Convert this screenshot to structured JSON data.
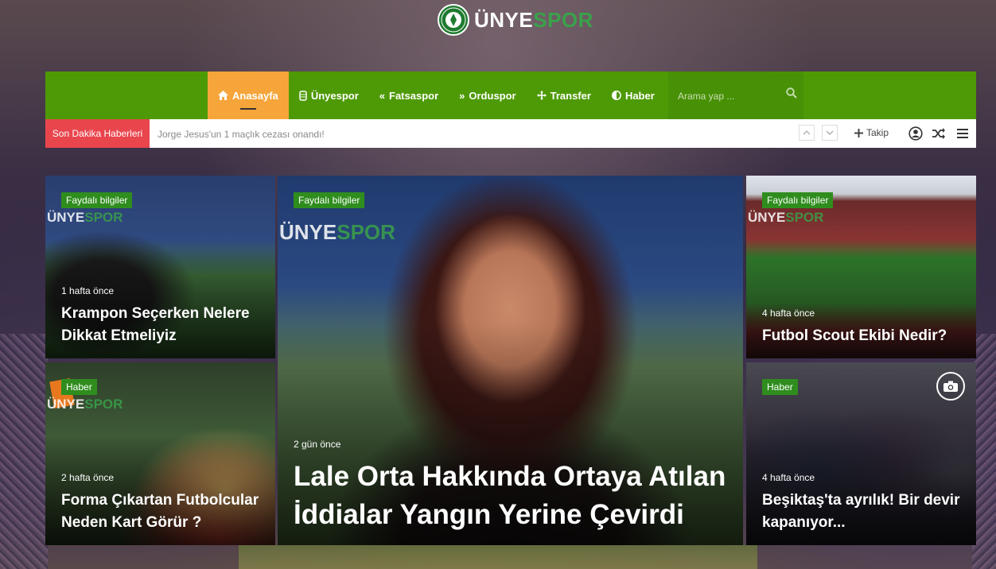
{
  "logo": {
    "part1": "ÜNYE",
    "part2": "SPOR",
    "badge_text": "ÜNYE SPOR"
  },
  "nav": {
    "items": [
      {
        "label": "Anasayfa",
        "icon": "home-icon",
        "active": true
      },
      {
        "label": "Ünyespor",
        "icon": "team-icon"
      },
      {
        "label": "Fatsaspor",
        "icon": "double-chevron-left-icon"
      },
      {
        "label": "Orduspor",
        "icon": "double-chevron-right-icon"
      },
      {
        "label": "Transfer",
        "icon": "arrows-move-icon"
      },
      {
        "label": "Haber",
        "icon": "half-circle-icon"
      }
    ],
    "search_placeholder": "Arama yap ..."
  },
  "ticker": {
    "label": "Son Dakika Haberleri",
    "headline": "Jorge Jesus'un 1 maçlık cezası onandı!",
    "follow_label": "Takip"
  },
  "watermark": {
    "part1": "ÜNYE",
    "part2": "SPOR"
  },
  "cards": {
    "top_left": {
      "category": "Faydalı bilgiler",
      "time": "1 hafta önce",
      "title": "Krampon Seçerken Nelere Dikkat Etmeliyiz"
    },
    "bottom_left": {
      "category": "Haber",
      "time": "2 hafta önce",
      "title": "Forma Çıkartan Futbolcular Neden Kart Görür ?"
    },
    "center": {
      "category": "Faydalı bilgiler",
      "time": "2 gün önce",
      "title": "Lale Orta Hakkında Ortaya Atılan İddialar Yangın Yerine Çevirdi"
    },
    "top_right": {
      "category": "Faydalı bilgiler",
      "time": "4 hafta önce",
      "title": "Futbol Scout Ekibi Nedir?"
    },
    "bottom_right": {
      "category": "Haber",
      "time": "4 hafta önce",
      "title": "Beşiktaş'ta ayrılık! Bir devir kapanıyor..."
    }
  },
  "colors": {
    "nav_green": "#4e9a06",
    "active_orange": "#f6a53b",
    "ticker_red": "#e9454d",
    "badge_green": "#2f8d1e",
    "brand_green": "#3aa14a"
  }
}
